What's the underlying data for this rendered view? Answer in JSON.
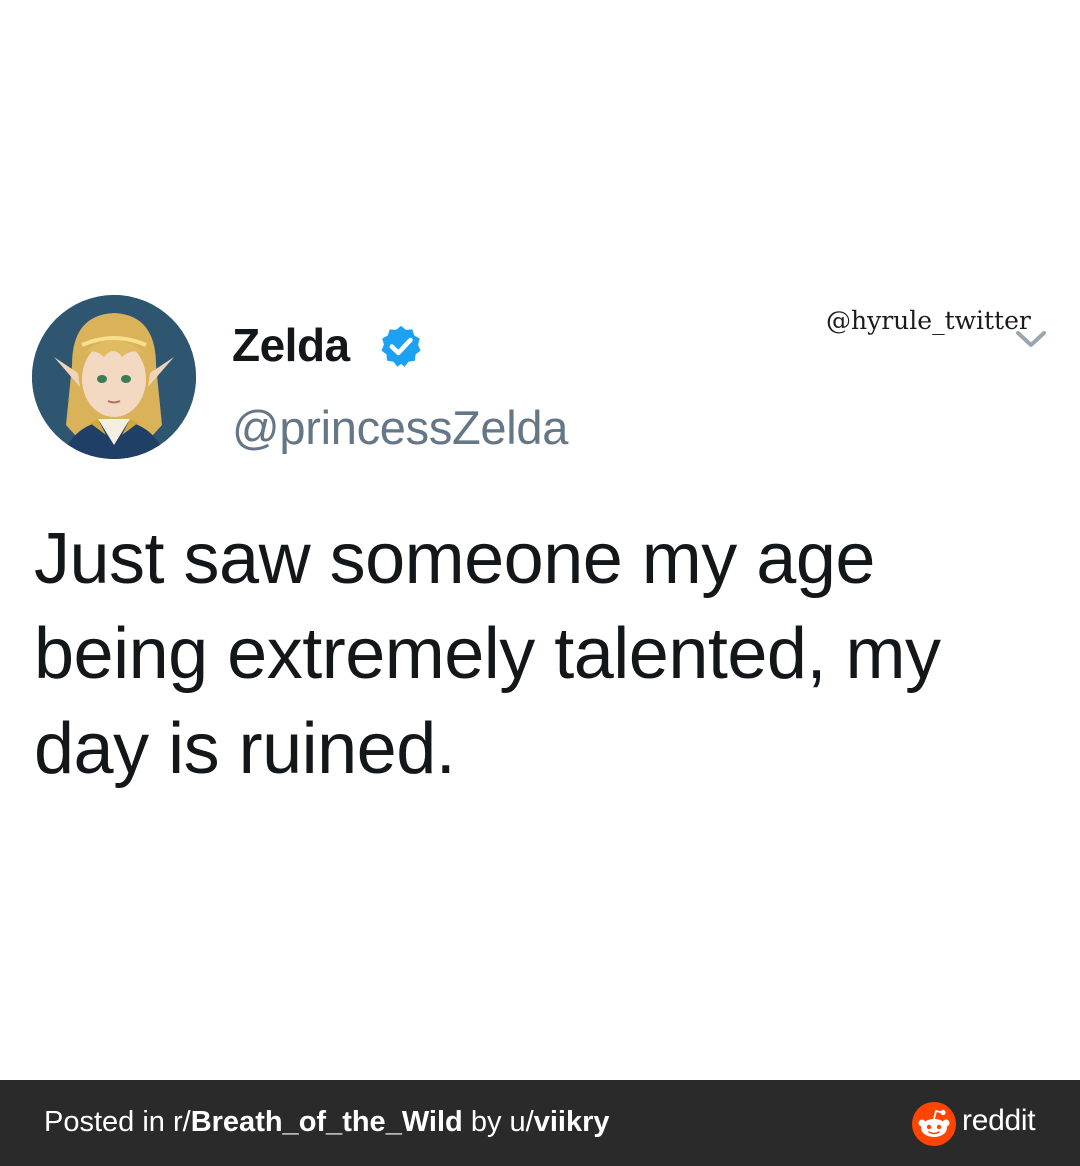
{
  "watermark": "@hyrule_twitter",
  "tweet": {
    "display_name": "Zelda",
    "handle": "@princessZelda",
    "text": "Just saw someone my age being extremely talented, my day is ruined.",
    "verified_icon": "verified-badge-icon",
    "more_icon": "chevron-down-icon"
  },
  "footer": {
    "posted_in_prefix": "Posted in ",
    "subreddit_prefix": "r/",
    "subreddit": "Breath_of_the_Wild",
    "by_text": " by ",
    "user_prefix": "u/",
    "username": "viikry",
    "brand": "reddit",
    "brand_icon": "reddit-alien-icon"
  },
  "colors": {
    "verified_blue": "#1da1f2",
    "handle_gray": "#657786",
    "footer_bg": "#2a2a2a",
    "reddit_orange": "#ff4500"
  }
}
